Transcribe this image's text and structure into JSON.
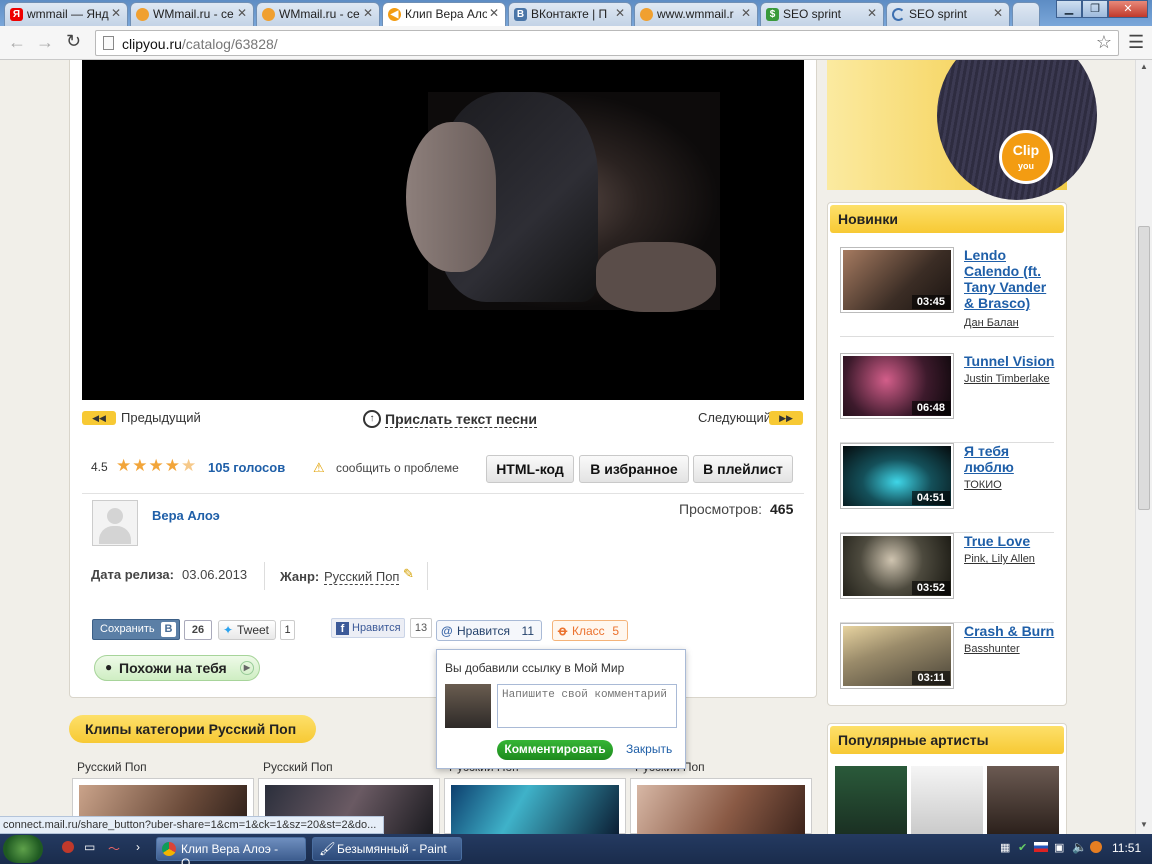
{
  "browser": {
    "tabs": [
      {
        "title": "wmmail — Янд",
        "icon": "yandex-icon"
      },
      {
        "title": "WMmail.ru - се",
        "icon": "wmmail-icon"
      },
      {
        "title": "WMmail.ru - се",
        "icon": "wmmail-icon"
      },
      {
        "title": "Клип Вера Ало",
        "icon": "clipyou-icon"
      },
      {
        "title": "ВКонтакте | П",
        "icon": "vk-icon"
      },
      {
        "title": "www.wmmail.r",
        "icon": "wmmail-icon"
      },
      {
        "title": "SEO sprint",
        "icon": "seosprint-icon"
      },
      {
        "title": "SEO sprint",
        "icon": "loading-icon"
      }
    ],
    "active_tab": 3,
    "url_host": "clipyou.ru",
    "url_path": "/catalog/63828/"
  },
  "player": {
    "prev_label": "Предыдущий",
    "lyrics_label": "Прислать текст песни",
    "next_label": "Следующий"
  },
  "rating": {
    "score": "4.5",
    "stars": 4.5,
    "votes_label": "105 голосов",
    "report_label": "сообщить о проблеме"
  },
  "actions": {
    "html_code": "HTML-код",
    "favorites": "В избранное",
    "playlist": "В плейлист"
  },
  "artist": {
    "name": "Вера Алоэ",
    "views_label": "Просмотров:",
    "views": "465"
  },
  "meta": {
    "release_label": "Дата релиза:",
    "release_date": "03.06.2013",
    "genre_label": "Жанр:",
    "genre": "Русский Поп"
  },
  "social": {
    "vk_save": "Сохранить",
    "vk_count": "26",
    "tweet": "Tweet",
    "tweet_count": "1",
    "fb_like": "Нравится",
    "fb_count": "13",
    "mm_like": "Нравится",
    "mm_count": "11",
    "ok_label": "Класс",
    "ok_count": "5"
  },
  "similar_label": "Похожи на тебя",
  "popup": {
    "title": "Вы добавили ссылку в Мой Мир",
    "placeholder": "Напишите свой комментарий",
    "comment_btn": "Комментировать",
    "close": "Закрыть"
  },
  "category": {
    "title": "Клипы категории Русский Поп",
    "links": [
      "Русский Поп",
      "Русский Поп",
      "Русский Поп",
      "Русский Поп"
    ]
  },
  "new_box": {
    "title": "Новинки",
    "items": [
      {
        "title": "Lendo Calendo (ft. Tany Vander & Brasco)",
        "artist": "Дан Балан",
        "duration": "03:45"
      },
      {
        "title": "Tunnel Vision",
        "artist": "Justin Timberlake",
        "duration": "06:48"
      },
      {
        "title": "Я тебя люблю",
        "artist": "ТОКИО",
        "duration": "04:51"
      },
      {
        "title": "True Love",
        "artist": "Pink, Lily Allen",
        "duration": "03:52"
      },
      {
        "title": "Crash & Burn",
        "artist": "Basshunter",
        "duration": "03:11"
      }
    ]
  },
  "popular_box": {
    "title": "Популярные артисты"
  },
  "status_url": "connect.mail.ru/share_button?uber-share=1&cm=1&ck=1&sz=20&st=2&do...",
  "taskbar": {
    "items": [
      "Клип Вера Алоэ - О...",
      "Безымянный - Paint"
    ],
    "clock": "11:51"
  },
  "colors": {
    "accent": "#f7c934",
    "link": "#1f5fa8",
    "green": "#2e9e2e"
  }
}
